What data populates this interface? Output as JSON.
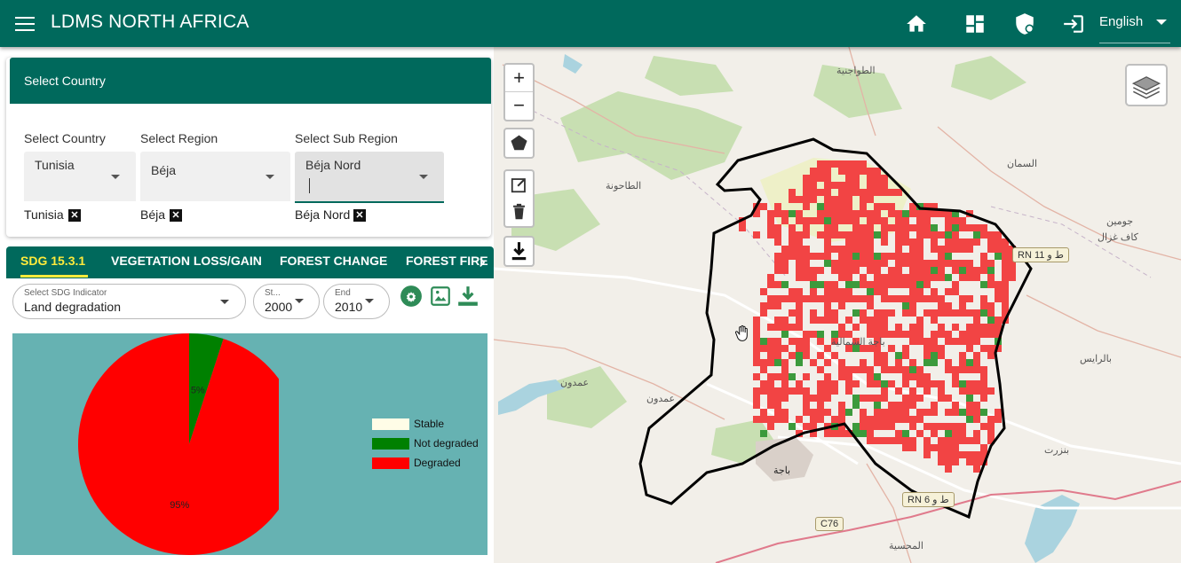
{
  "header": {
    "title": "LDMS NORTH AFRICA",
    "language": "English",
    "icons": [
      "menu-icon",
      "home-icon",
      "dashboard-icon",
      "admin-shield-icon",
      "login-icon",
      "chevron-down-icon"
    ]
  },
  "country_panel": {
    "title": "Select Country",
    "country": {
      "label": "Select Country",
      "value": "Tunisia",
      "chip": "Tunisia"
    },
    "region": {
      "label": "Select Region",
      "value": "Béja",
      "chip": "Béja"
    },
    "subregion": {
      "label": "Select Sub Region",
      "value": "Béja Nord",
      "chip": "Béja Nord"
    },
    "chip_close": "✕"
  },
  "tabs": [
    {
      "label": "SDG 15.3.1",
      "active": true
    },
    {
      "label": "VEGETATION LOSS/GAIN"
    },
    {
      "label": "FOREST CHANGE"
    },
    {
      "label": "FOREST FIRE"
    }
  ],
  "controls": {
    "indicator": {
      "label": "Select SDG Indicator",
      "value": "Land degradation"
    },
    "start": {
      "label": "St...",
      "value": "2000"
    },
    "end": {
      "label": "End",
      "value": "2010"
    }
  },
  "chart_data": {
    "type": "pie",
    "slices": [
      {
        "name": "Stable",
        "value": 0,
        "label": "",
        "color": "#fffde7"
      },
      {
        "name": "Not degraded",
        "value": 5,
        "label": "5%",
        "color": "#008000"
      },
      {
        "name": "Degraded",
        "value": 95,
        "label": "95%",
        "color": "#ff0000"
      }
    ],
    "legend": [
      "Stable",
      "Not degraded",
      "Degraded"
    ],
    "legend_placement": "right"
  },
  "map": {
    "zoom_in": "+",
    "zoom_out": "−",
    "road_labels": [
      "RN 11 ط و",
      "RN 6 ط و",
      "C76"
    ],
    "place_labels": [
      "عمدون",
      "باجة",
      "السمان",
      "جومين",
      "كاف غزال",
      "الطاحونة",
      "الطواجنية",
      "عمدون",
      "المحسية",
      "بالرايس",
      "بنزرت",
      "باجة الشمالية"
    ]
  }
}
